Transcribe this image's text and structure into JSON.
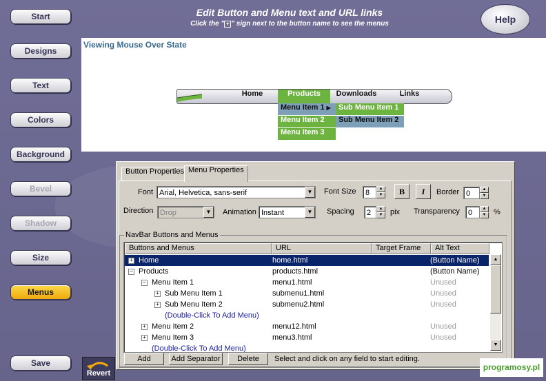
{
  "header": {
    "title": "Edit Button and Menu text and URL links",
    "subtitle_pre": "Click the \"",
    "subtitle_post": "\" sign next to the button name to see the menus",
    "help": "Help"
  },
  "nav": [
    {
      "label": "Start",
      "state": "normal"
    },
    {
      "label": "Designs",
      "state": "normal"
    },
    {
      "label": "Text",
      "state": "normal"
    },
    {
      "label": "Colors",
      "state": "normal"
    },
    {
      "label": "Background",
      "state": "normal"
    },
    {
      "label": "Bevel",
      "state": "disabled"
    },
    {
      "label": "Shadow",
      "state": "disabled"
    },
    {
      "label": "Size",
      "state": "normal"
    },
    {
      "label": "Menus",
      "state": "active"
    },
    {
      "label": "Save",
      "state": "normal"
    }
  ],
  "preview": {
    "title": "Viewing Mouse Over State",
    "menubar": [
      "Home",
      "Products",
      "Downloads",
      "Links"
    ],
    "submenu": [
      "Menu Item 1",
      "Menu Item 2",
      "Menu Item 3"
    ],
    "subsubmenu": [
      "Sub Menu Item 1",
      "Sub Menu Item 2"
    ]
  },
  "dialog": {
    "tabs": [
      "Button Properties",
      "Menu Properties"
    ],
    "font_label": "Font",
    "font_value": "Arial, Helvetica, sans-serif",
    "fontsize_label": "Font Size",
    "fontsize_value": "8",
    "bold": "B",
    "italic": "I",
    "border_label": "Border",
    "border_value": "0",
    "direction_label": "Direction",
    "direction_value": "Drop",
    "animation_label": "Animation",
    "animation_value": "Instant",
    "spacing_label": "Spacing",
    "spacing_value": "2",
    "spacing_unit": "pix",
    "transparency_label": "Transparency",
    "transparency_value": "0",
    "transparency_unit": "%",
    "group_label": "NavBar Buttons and Menus",
    "columns": [
      "Buttons and Menus",
      "URL",
      "Target Frame",
      "Alt Text"
    ],
    "rows": [
      {
        "name": "Home",
        "url": "home.html",
        "frame": "",
        "alt": "(Button Name)",
        "dim": false
      },
      {
        "name": "Products",
        "url": "products.html",
        "frame": "",
        "alt": "(Button Name)",
        "dim": false
      },
      {
        "name": "Menu Item 1",
        "url": "menu1.html",
        "frame": "",
        "alt": "Unused",
        "dim": true
      },
      {
        "name": "Sub Menu Item 1",
        "url": "submenu1.html",
        "frame": "",
        "alt": "Unused",
        "dim": true
      },
      {
        "name": "Sub Menu Item 2",
        "url": "submenu2.html",
        "frame": "",
        "alt": "Unused",
        "dim": true
      },
      {
        "name": "(Double-Click To Add Menu)",
        "url": "",
        "frame": "",
        "alt": "",
        "dim": false
      },
      {
        "name": "Menu Item 2",
        "url": "menu12.html",
        "frame": "",
        "alt": "Unused",
        "dim": true
      },
      {
        "name": "Menu Item 3",
        "url": "menu3.html",
        "frame": "",
        "alt": "Unused",
        "dim": true
      },
      {
        "name": "(Double-Click To Add Menu)",
        "url": "",
        "frame": "",
        "alt": "",
        "dim": false
      }
    ],
    "buttons": [
      "Add",
      "Add Separator",
      "Delete"
    ],
    "hint": "Select and click on any field to start editing."
  },
  "revert": "Revert",
  "watermark": "programosy.pl",
  "colors": {
    "accent": "#6cb33f",
    "selection": "#0a246a",
    "active_nav": "#f1a90d"
  }
}
